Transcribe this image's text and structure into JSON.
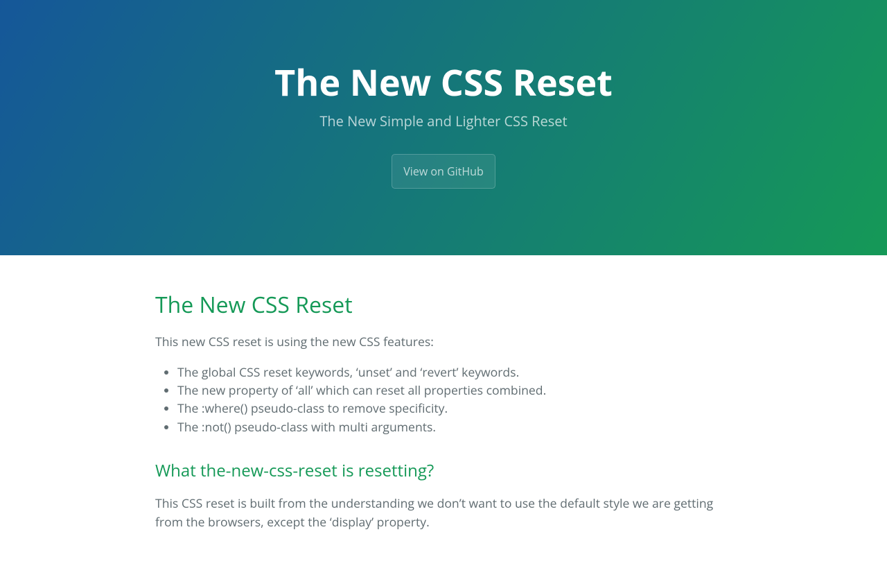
{
  "header": {
    "title": "The New CSS Reset",
    "tagline": "The New Simple and Lighter CSS Reset",
    "github_button": "View on GitHub"
  },
  "main": {
    "heading1": "The New CSS Reset",
    "intro": "This new CSS reset is using the new CSS features:",
    "features": [
      "The global CSS reset keywords, ‘unset’ and ‘revert’ keywords.",
      "The new property of ‘all’ which can reset all properties combined.",
      "The :where() pseudo-class to remove specificity.",
      "The :not() pseudo-class with multi arguments."
    ],
    "heading2": "What the-new-css-reset is resetting?",
    "para2": "This CSS reset is built from the understanding we don’t want to use the default style we are getting from the browsers, except the ‘display’ property."
  }
}
